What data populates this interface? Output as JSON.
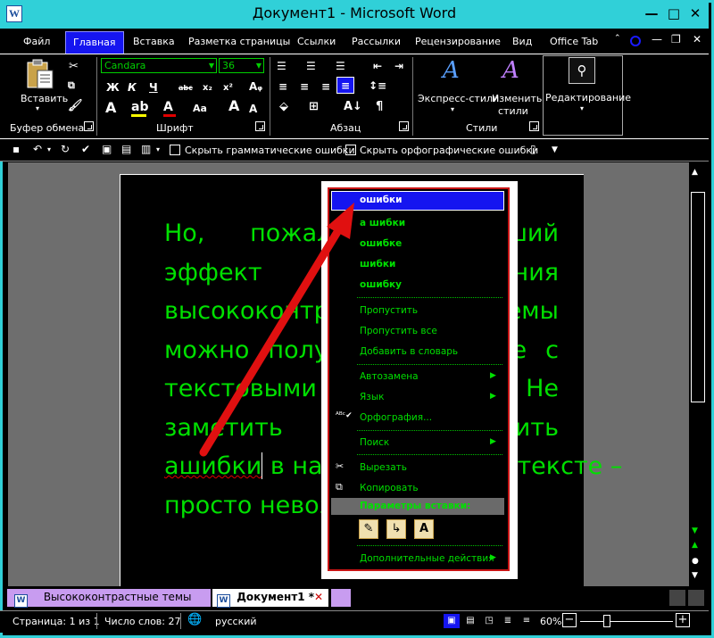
{
  "window": {
    "title": "Документ1 - Microsoft Word",
    "app_icon_letter": "W",
    "min_label": "—",
    "max_label": "□",
    "close_label": "✕"
  },
  "menu": {
    "tabs": [
      "Файл",
      "Главная",
      "Вставка",
      "Разметка страницы",
      "Ссылки",
      "Рассылки",
      "Рецензирование",
      "Вид",
      "Office Tab"
    ],
    "active_tab": "Главная",
    "extra_minimize": "—",
    "extra_restore": "❐",
    "extra_close": "✕"
  },
  "ribbon": {
    "clipboard": {
      "label": "Буфер обмена",
      "paste": "Вставить"
    },
    "font": {
      "label": "Шрифт",
      "font_name": "Candara",
      "font_size": "36"
    },
    "paragraph": {
      "label": "Абзац"
    },
    "styles": {
      "label": "Стили",
      "express": "Экспресс-стили",
      "change_1": "Изменить",
      "change_2": "стили"
    },
    "editing": {
      "label": "Редактирование"
    }
  },
  "quick_access": {
    "hide_grammar": "Скрыть грамматические ошибки",
    "hide_spelling": "Скрыть орфографические ошибки"
  },
  "document": {
    "lines": [
      "Но, пожалуй, наилучший",
      "эффект применения",
      "высококонтрастной темы",
      "можно получить в работе с",
      "текстовыми документами. Не",
      "заметить или пропустить",
      "в наборе ошибки в тексте –",
      "просто невозможно."
    ],
    "misspelled_word": "ашибки"
  },
  "context_menu": {
    "suggestions": [
      "ошибки",
      "а шибки",
      "ошибке",
      "шибки",
      "ошибку"
    ],
    "skip": "Пропустить",
    "skip_all": "Пропустить все",
    "add_to_dictionary": "Добавить в словарь",
    "autocorrect": "Автозамена",
    "language": "Язык",
    "spelling": "Орфография...",
    "search": "Поиск",
    "cut": "Вырезать",
    "copy": "Копировать",
    "paste_options": "Параметры вставки:",
    "more_actions": "Дополнительные действия"
  },
  "doc_tabs": {
    "tab1": "Высококонтрастные темы",
    "tab2": "Документ1 *"
  },
  "status": {
    "page": "Страница: 1 из 1",
    "words": "Число слов: 27",
    "language": "русский",
    "zoom": "60%"
  },
  "colors": {
    "accent_window": "#30d0d8",
    "highlight": "#1515f0",
    "text_green": "#00e000",
    "arrow_red": "#e01010"
  }
}
